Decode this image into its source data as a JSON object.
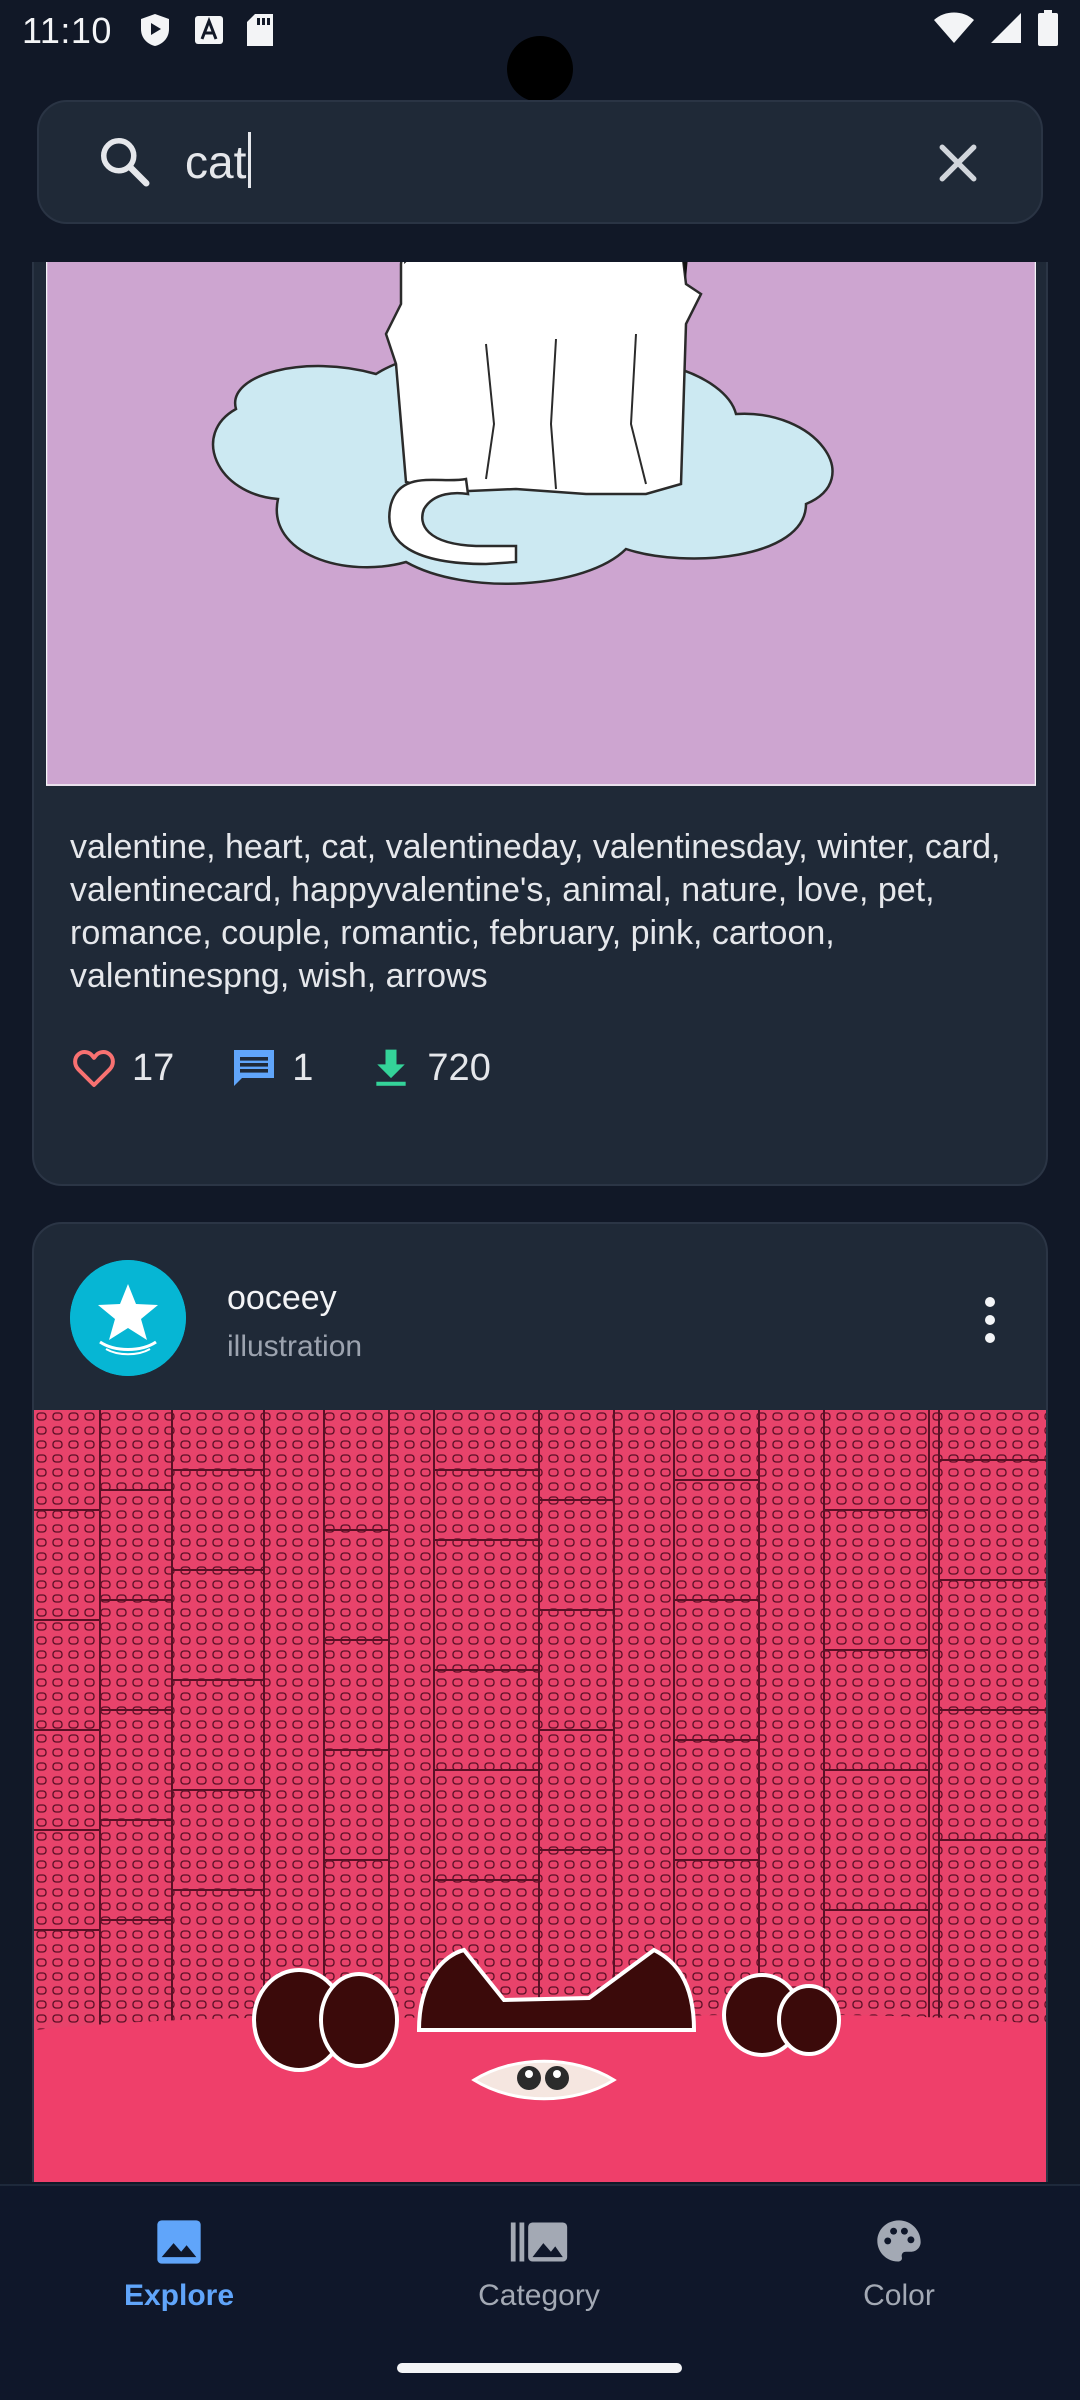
{
  "status_bar": {
    "time": "11:10"
  },
  "search": {
    "value": "cat",
    "placeholder": ""
  },
  "feed": {
    "posts": [
      {
        "tags": "valentine, heart, cat, valentineday, valentinesday, winter, card, valentinecard, happyvalentine's, animal, nature, love, pet, romance, couple, romantic, february, pink, cartoon, valentinespng, wish, arrows",
        "likes": "17",
        "comments": "1",
        "downloads": "720"
      },
      {
        "author": "ooceey",
        "type": "illustration"
      }
    ]
  },
  "bottom_nav": {
    "items": [
      {
        "label": "Explore",
        "icon": "image-icon",
        "active": true
      },
      {
        "label": "Category",
        "icon": "library-icon",
        "active": false
      },
      {
        "label": "Color",
        "icon": "palette-icon",
        "active": false
      }
    ]
  },
  "colors": {
    "background": "#111827",
    "card": "#1f2937",
    "accent": "#60a5fa",
    "like": "#f87171",
    "comment": "#60a5fa",
    "download": "#34d399"
  }
}
